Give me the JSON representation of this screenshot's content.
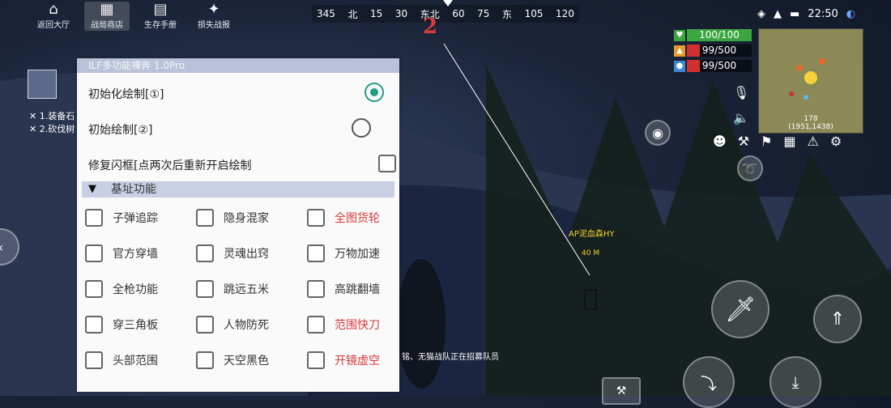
{
  "top_nav": [
    {
      "label": "返回大厅",
      "icon": "home-icon",
      "glyph": "⌂",
      "active": false
    },
    {
      "label": "战局商店",
      "icon": "shop-icon",
      "glyph": "▦",
      "active": true
    },
    {
      "label": "生存手册",
      "icon": "book-icon",
      "glyph": "▤",
      "active": false
    },
    {
      "label": "损失战报",
      "icon": "report-icon",
      "glyph": "✦",
      "active": false
    }
  ],
  "compass": {
    "ticks": [
      "345",
      "北",
      "15",
      "30",
      "东北",
      "60",
      "75",
      "东",
      "105",
      "120"
    ],
    "marker": "2"
  },
  "status": {
    "time": "22:50"
  },
  "bars": [
    {
      "icon": "heart-icon",
      "glyph": "♥",
      "value": "100/100",
      "color": "#3aa640",
      "fill": 1.0
    },
    {
      "icon": "food-icon",
      "glyph": "▲",
      "value": "99/500",
      "color": "#d03030",
      "fill": 0.2
    },
    {
      "icon": "water-icon",
      "glyph": "●",
      "value": "99/500",
      "color": "#d03030",
      "fill": 0.2
    }
  ],
  "minimap": {
    "distance": "178",
    "coords": "(1951,1438)"
  },
  "tasks": [
    "1.装备石",
    "2.砍伐树"
  ],
  "target": {
    "name": "AP泥血森HY",
    "distance": "40 M"
  },
  "chat": "铭、无猫战队正在招募队员",
  "panel": {
    "title": "ILF多功能裸奔 1.0Pro",
    "options": [
      {
        "label": "初始化绘制[①]",
        "type": "radio",
        "checked": true
      },
      {
        "label": "初始绘制[②]",
        "type": "radio",
        "checked": false
      },
      {
        "label": "修复闪框[点两次后重新开启绘制",
        "type": "checkbox",
        "checked": false
      }
    ],
    "section": "基址功能",
    "features": [
      [
        {
          "label": "子弹追踪",
          "red": false
        },
        {
          "label": "隐身混家",
          "red": false
        },
        {
          "label": "全图货轮",
          "red": true
        }
      ],
      [
        {
          "label": "官方穿墙",
          "red": false
        },
        {
          "label": "灵魂出窍",
          "red": false
        },
        {
          "label": "万物加速",
          "red": false
        }
      ],
      [
        {
          "label": "全枪功能",
          "red": false
        },
        {
          "label": "跳远五米",
          "red": false
        },
        {
          "label": "高跳翻墙",
          "red": false
        }
      ],
      [
        {
          "label": "穿三角板",
          "red": false
        },
        {
          "label": "人物防死",
          "red": false
        },
        {
          "label": "范围快刀",
          "red": true
        }
      ],
      [
        {
          "label": "头部范围",
          "red": false
        },
        {
          "label": "天空黑色",
          "red": false
        },
        {
          "label": "开镜虚空",
          "red": true
        }
      ]
    ]
  }
}
